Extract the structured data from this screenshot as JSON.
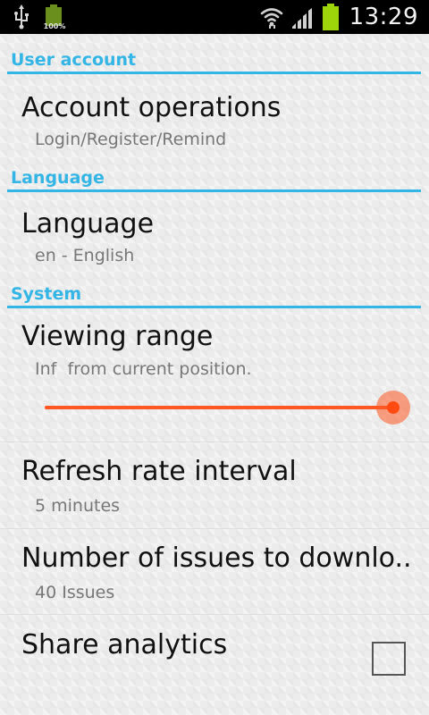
{
  "status_bar": {
    "battery_small_label": "100%",
    "time": "13:29",
    "icons": [
      "usb-icon",
      "battery-icon",
      "wifi-icon",
      "signal-icon",
      "battery-icon"
    ]
  },
  "categories": {
    "user_account": "User account",
    "language": "Language",
    "system": "System"
  },
  "prefs": {
    "account_operations": {
      "title": "Account operations",
      "summary": "Login/Register/Remind"
    },
    "language": {
      "title": "Language",
      "summary": "en - English"
    },
    "viewing_range": {
      "title": "Viewing range",
      "summary_value": "Inf",
      "summary_text": "from current position.",
      "slider_fraction": 1.0
    },
    "refresh_rate": {
      "title": "Refresh rate interval",
      "summary": "5 minutes"
    },
    "issues_count": {
      "title": "Number of issues to downlo..",
      "summary": "40 Issues"
    },
    "share_analytics": {
      "title": "Share analytics",
      "checked": false
    }
  },
  "colors": {
    "accent": "#33b5e5",
    "slider": "#ff5722",
    "status_bar": "#000000",
    "battery_green": "#9ed40a"
  }
}
